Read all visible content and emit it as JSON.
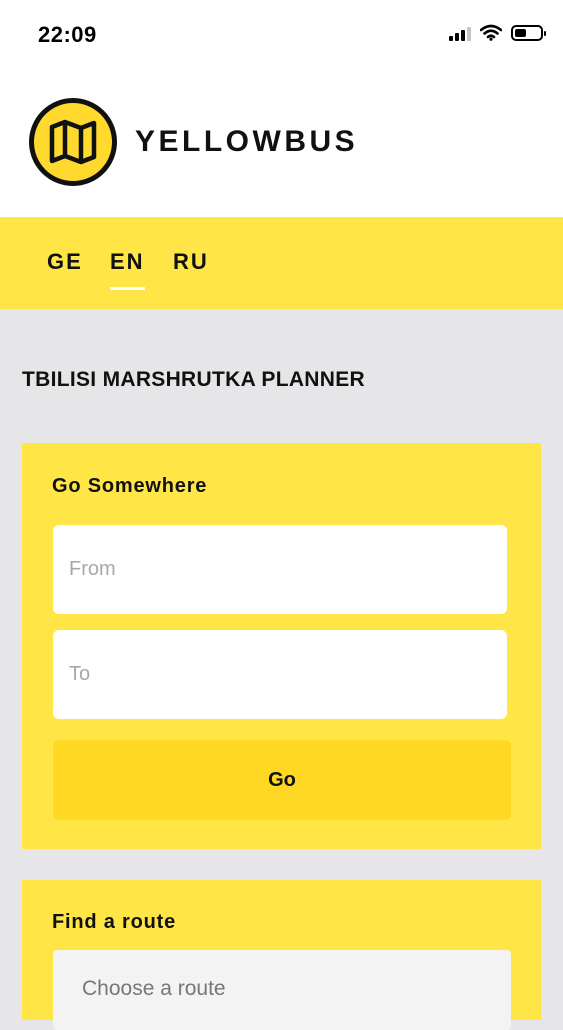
{
  "status_bar": {
    "time": "22:09",
    "icons": [
      "signal-icon",
      "wifi-icon",
      "battery-icon"
    ]
  },
  "brand": {
    "logo_icon": "map-icon",
    "name": "YELLOWBUS"
  },
  "languages": {
    "items": [
      {
        "label": "GE",
        "active": false
      },
      {
        "label": "EN",
        "active": true
      },
      {
        "label": "RU",
        "active": false
      }
    ]
  },
  "page": {
    "title": "TBILISI MARSHRUTKA PLANNER"
  },
  "go_somewhere": {
    "title": "Go Somewhere",
    "from_placeholder": "From",
    "from_value": "",
    "to_placeholder": "To",
    "to_value": "",
    "go_label": "Go"
  },
  "find_route": {
    "title": "Find a route",
    "select_placeholder": "Choose a route"
  },
  "colors": {
    "accent_yellow": "#ffe545",
    "button_yellow": "#ffd824",
    "logo_yellow": "#ffd92e",
    "background_grey": "#e6e6e9"
  }
}
